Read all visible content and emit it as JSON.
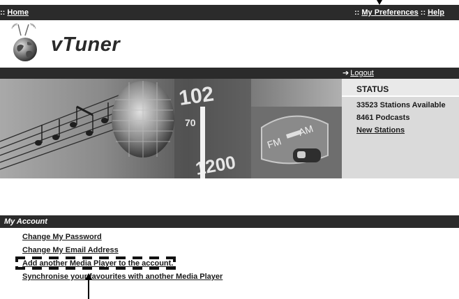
{
  "topnav": {
    "home_prefix": ":: ",
    "home_label": "Home",
    "prefs_prefix": ":: ",
    "prefs_label": "My Preferences",
    "help_prefix": " :: ",
    "help_label": "Help"
  },
  "logo": {
    "text": "vTuner"
  },
  "logout_bar": {
    "arrow": "➔",
    "logout_label": "Logout"
  },
  "status": {
    "title": "STATUS",
    "stations": "33523  Stations Available",
    "podcasts": "8461  Podcasts",
    "new_stations": "New Stations"
  },
  "account": {
    "title": "My Account",
    "links": [
      "Change My Password",
      "Change My Email Address",
      "Add another Media Player to the account.",
      "Synchronise your favourites with another Media Player"
    ]
  },
  "colors": {
    "nav_bg": "#2b2b2b",
    "status_bg": "#dadada",
    "banner_gray": "#8f8f8f"
  }
}
